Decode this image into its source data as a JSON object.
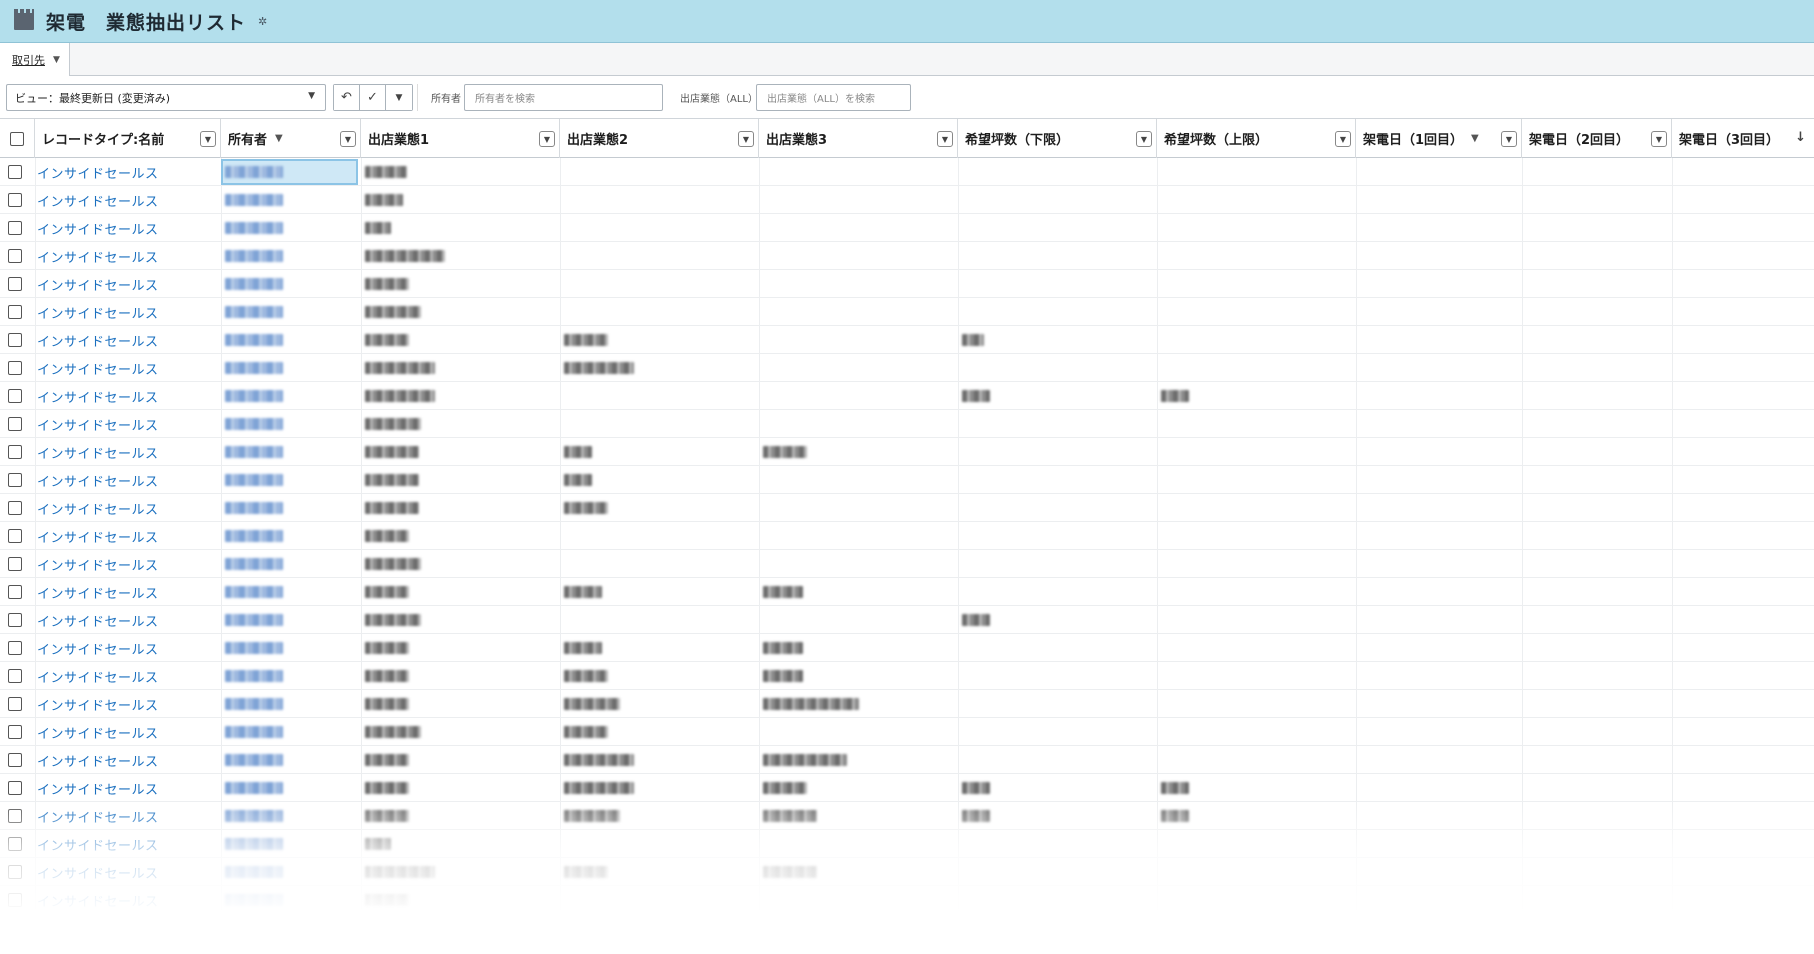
{
  "header": {
    "title": "架電　業態抽出リスト",
    "icon": "folder-icon",
    "gear_icon": "gear-icon"
  },
  "tabs": [
    {
      "label": "取引先",
      "active": true
    }
  ],
  "toolbar": {
    "view_label": "ビュー：最終更新日 (変更済み)",
    "undo_icon": "undo-icon",
    "check_icon": "check-icon",
    "more_icon": "chevron-down-icon",
    "owner_filter_label": "所有者",
    "owner_filter_placeholder": "所有者を検索",
    "category_filter_label": "出店業態（ALL）",
    "category_filter_placeholder": "出店業態（ALL）を検索"
  },
  "grid": {
    "columns": [
      {
        "label": "レコードタイプ:名前"
      },
      {
        "label": "所有者"
      },
      {
        "label": "出店業態1"
      },
      {
        "label": "出店業態2"
      },
      {
        "label": "出店業態3"
      },
      {
        "label": "希望坪数（下限）"
      },
      {
        "label": "希望坪数（上限）"
      },
      {
        "label": "架電日（1回目）"
      },
      {
        "label": "架電日（2回目）"
      },
      {
        "label": "架電日（3回目）"
      }
    ],
    "row_label": "インサイドセールス",
    "row_count": 27,
    "accent_color": "#1a6fbf"
  }
}
